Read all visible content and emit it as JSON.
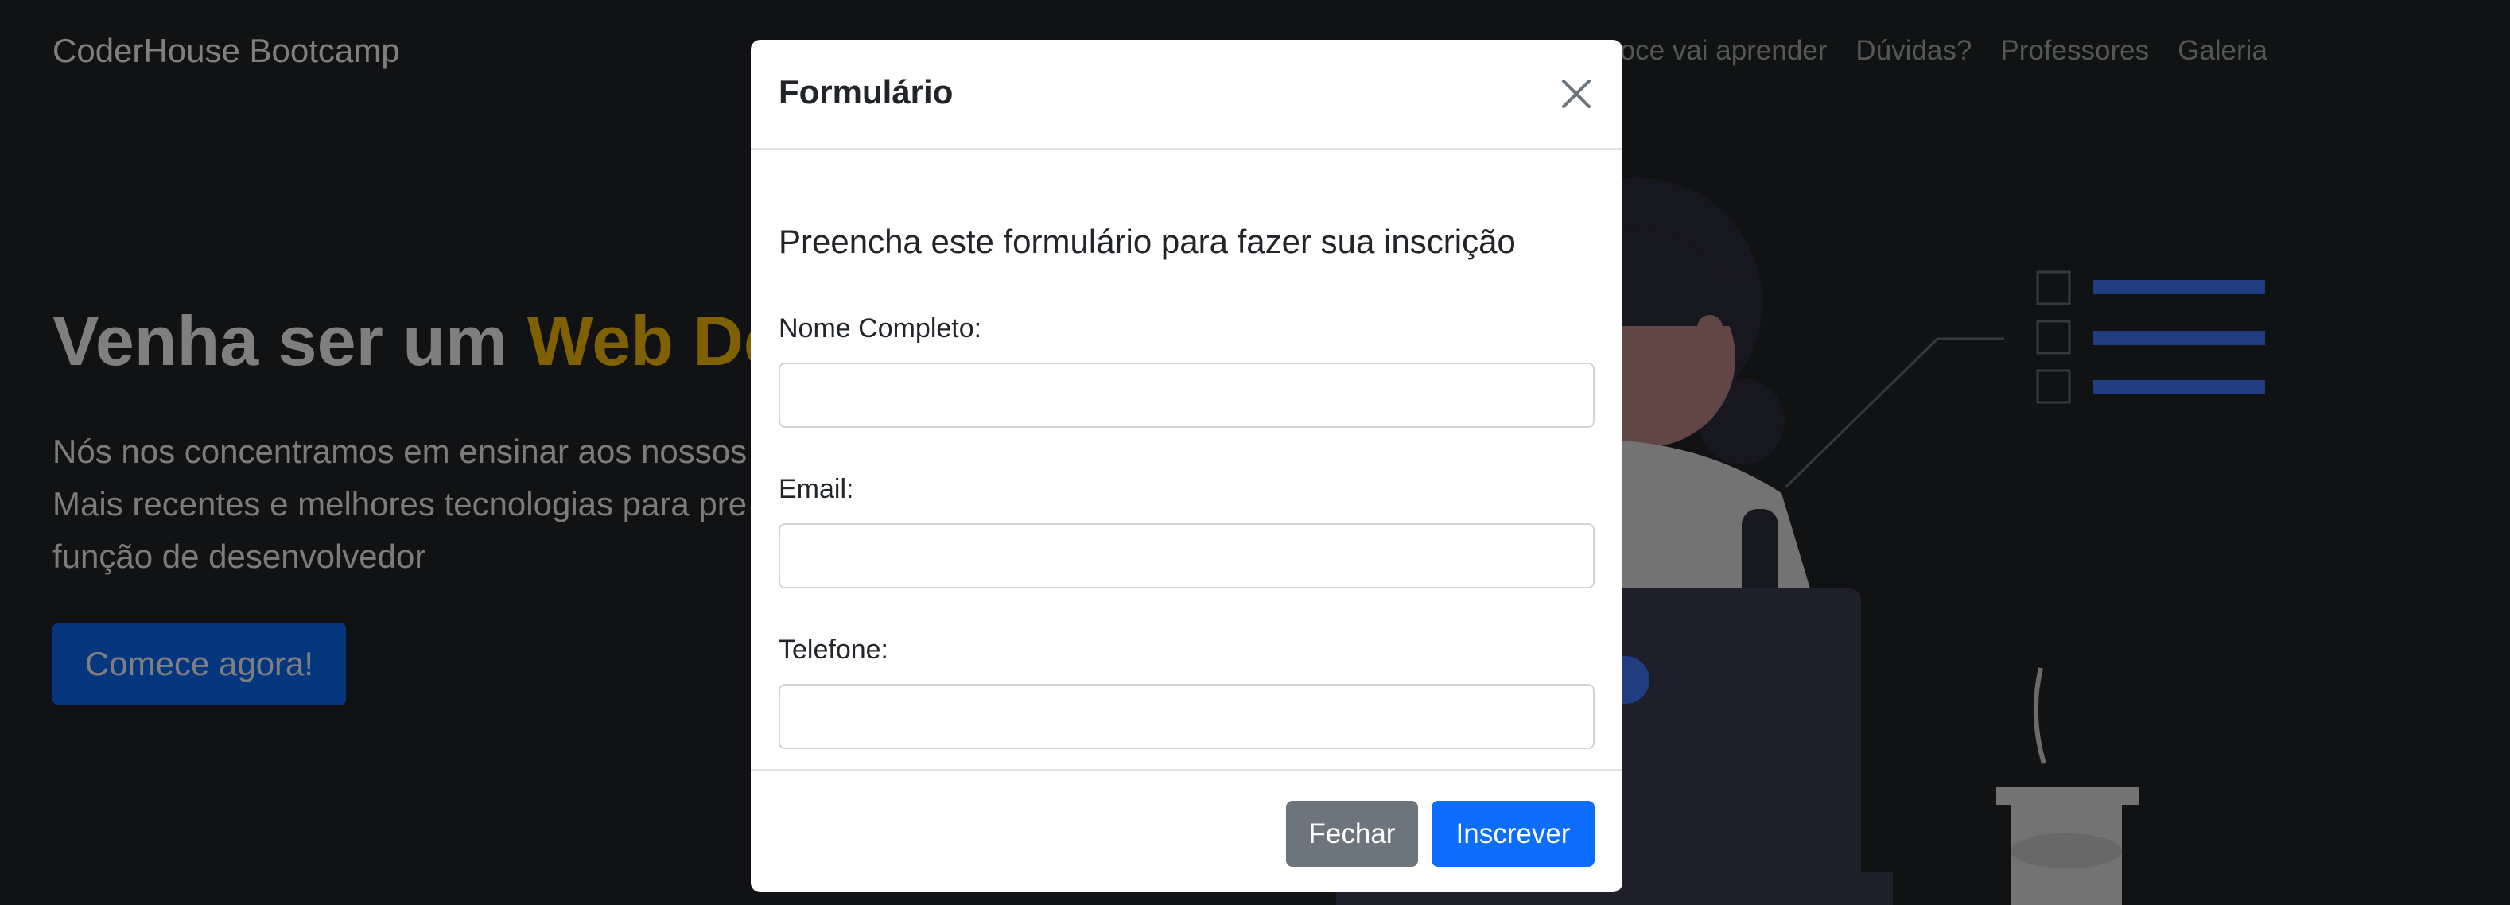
{
  "navbar": {
    "brand": "CoderHouse Bootcamp",
    "links": [
      "e voce vai aprender",
      "Dúvidas?",
      "Professores",
      "Galeria"
    ]
  },
  "hero": {
    "title_prefix": "Venha ser um ",
    "title_accent": "Web Dev",
    "lines": [
      "Nós nos concentramos em ensinar aos nossos",
      "Mais recentes e melhores tecnologias para pre",
      "função de desenvolvedor"
    ],
    "cta_label": "Comece agora!"
  },
  "modal": {
    "title": "Formulário",
    "lead": "Preencha este formulário para fazer sua inscrição",
    "fields": [
      {
        "label": "Nome Completo:",
        "value": ""
      },
      {
        "label": "Email:",
        "value": ""
      },
      {
        "label": "Telefone:",
        "value": ""
      }
    ],
    "close_label": "Fechar",
    "submit_label": "Inscrever"
  },
  "colors": {
    "page_bg": "#212529",
    "accent": "#ffc107",
    "primary": "#0d6efd",
    "secondary": "#6c757d"
  }
}
